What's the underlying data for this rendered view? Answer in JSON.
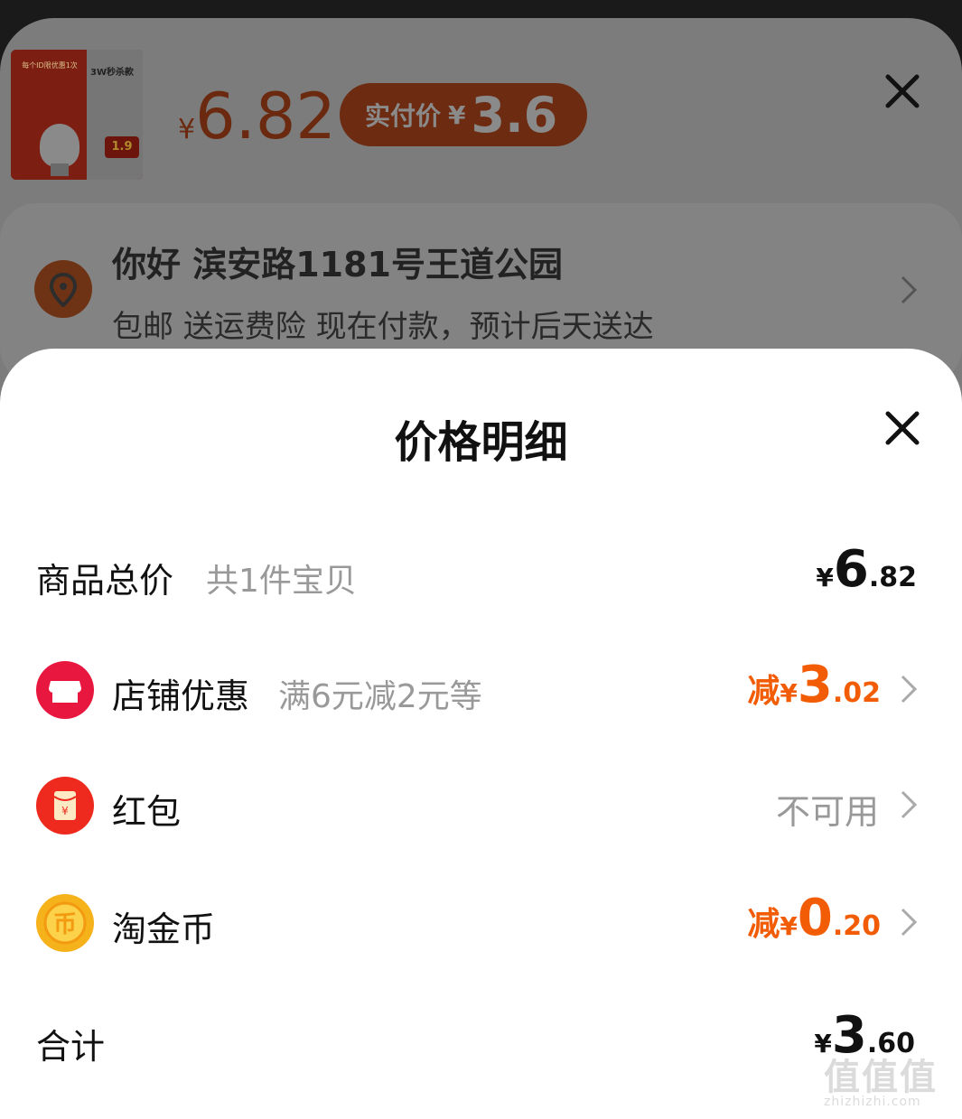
{
  "background": {
    "product": {
      "thumb_caption": "每个ID限优惠1次",
      "thumb_badge": "3W秒杀款",
      "thumb_price": "1.9",
      "price_currency": "¥",
      "price_value": "6.82",
      "paid_label": "实付价",
      "paid_currency": "¥",
      "paid_value": "3.6"
    },
    "address": {
      "name_line": "你好 滨安路1181号王道公园",
      "sub_line": "包邮 送运费险 现在付款，预计后天送达"
    }
  },
  "sheet": {
    "title": "价格明细",
    "rows": [
      {
        "label": "商品总价",
        "sub": "共1件宝贝",
        "currency": "¥",
        "int": "6",
        "dec": ".82"
      },
      {
        "icon": "store-icon",
        "label": "店铺优惠",
        "sub": "满6元减2元等",
        "prefix": "减",
        "currency": "¥",
        "int": "3",
        "dec": ".02"
      },
      {
        "icon": "red-packet-icon",
        "label": "红包",
        "status": "不可用"
      },
      {
        "icon": "gold-coin-icon",
        "label": "淘金币",
        "prefix": "减",
        "currency": "¥",
        "int": "0",
        "dec": ".20"
      },
      {
        "label": "合计",
        "currency": "¥",
        "int": "3",
        "dec": ".60"
      }
    ]
  },
  "watermark": {
    "big": "值值值",
    "small": "zhizhizhi.com"
  },
  "colors": {
    "accent": "#f25c05",
    "store_icon": "#e8173f",
    "red_packet_icon": "#ee2a1e",
    "coin_icon": "#f6b21b"
  }
}
